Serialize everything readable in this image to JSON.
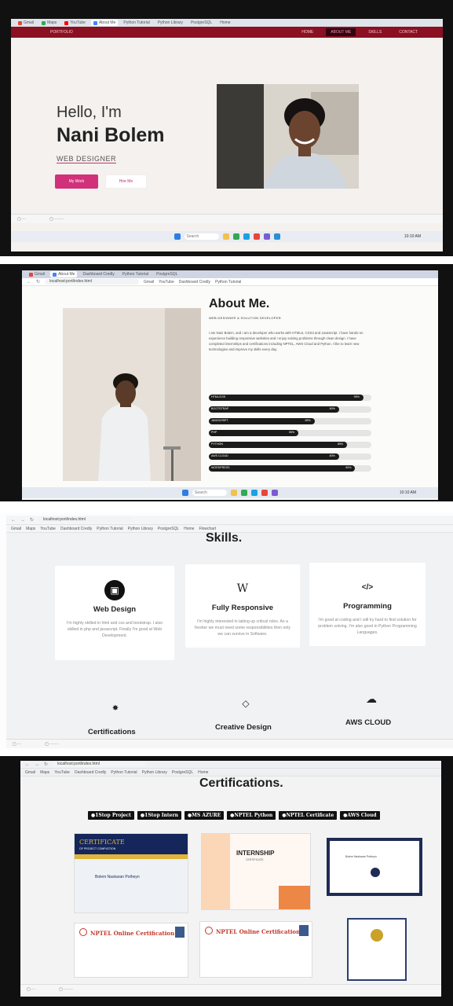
{
  "browser": {
    "bookmarks_bar": [
      "Gmail",
      "Maps",
      "YouTube",
      "Dashboard Credly",
      "Python Tutorial",
      "Python Library",
      "PostgreSQL",
      "Home",
      "Flowchart"
    ],
    "url": "localhost:port/index.html",
    "active_tab_label": "About Me"
  },
  "hero": {
    "nav_items": [
      "HOME",
      "ABOUT ME",
      "SKILLS",
      "CONTACT"
    ],
    "active_nav": "ABOUT ME",
    "greeting": "Hello, I'm",
    "name": "Nani Bolem",
    "role": "WEB DESIGNER",
    "primary_button": "My Work",
    "secondary_button": "Hire Me"
  },
  "about": {
    "title": "About Me.",
    "subtitle": "WEB DESIGNER & SOLUTION DEVELOPER",
    "paragraph": "I am Nani Bolem, and I am a developer who works with HTML5, CSS3 and JavaScript. I have hands-on experience building responsive websites and I enjoy solving problems through clean design. I have completed internships and certifications including NPTEL, AWS Cloud and Python. I like to learn new technologies and improve my skills every day.",
    "skills": [
      {
        "label": "HTML/CSS",
        "value": 95
      },
      {
        "label": "BOOTSTRAP",
        "value": 80
      },
      {
        "label": "JAVASCRIPT",
        "value": 65
      },
      {
        "label": "PHP",
        "value": 55
      },
      {
        "label": "PYTHON",
        "value": 85
      },
      {
        "label": "AWS CLOUD",
        "value": 80
      },
      {
        "label": "WORDPRESS",
        "value": 90
      }
    ]
  },
  "skills_section": {
    "title": "Skills.",
    "cards": [
      {
        "title": "Web Design",
        "icon": "monitor-icon",
        "glyph": "▣",
        "desc": "I'm highly skilled in html and css and bootstrap. I also skilled in php and javascript. Finally I'm good at Web Development."
      },
      {
        "title": "Fully Responsive",
        "icon": "wordpress-icon",
        "glyph": "W",
        "desc": "I'm highly interested in taking up critical roles. As a fresher we must need some responsibilities then only we can survive in Software."
      },
      {
        "title": "Programming",
        "icon": "code-icon",
        "glyph": "</>",
        "desc": "I'm good at coding and I will try hard to find solution for problem solving. I'm also good in Python Programming Languages."
      }
    ],
    "more_cards": [
      {
        "title": "Certifications",
        "icon": "certificate-icon",
        "glyph": "✸"
      },
      {
        "title": "Creative Design",
        "icon": "diamond-icon",
        "glyph": "◇"
      },
      {
        "title": "AWS CLOUD",
        "icon": "cloud-icon",
        "glyph": "☁"
      }
    ]
  },
  "certifications": {
    "title": "Certifications.",
    "filters": [
      "1Stop Project",
      "1Stop Intern",
      "MS AZURE",
      "NPTEL Python",
      "NPTEL Certificate",
      "AWS Cloud"
    ],
    "cards": [
      {
        "heading": "CERTIFICATE",
        "sub": "OF PROJECT COMPLETION",
        "person": "Bolem Naskaran Potheyn"
      },
      {
        "heading": "INTERNSHIP",
        "sub": "CERTIFICATE",
        "person": ""
      },
      {
        "heading": "",
        "sub": "",
        "person": "Bolem Naskaran Potheyn"
      },
      {
        "heading": "NPTEL Online Certification",
        "sub": "",
        "person": ""
      },
      {
        "heading": "NPTEL Online Certification",
        "sub": "",
        "person": ""
      },
      {
        "heading": "",
        "sub": "",
        "person": ""
      }
    ]
  },
  "taskbar": {
    "search_label": "Search",
    "time": "10:10 AM"
  },
  "colors": {
    "accent": "#d1307a",
    "nav_bg": "#8b1022",
    "dark": "#111111"
  }
}
